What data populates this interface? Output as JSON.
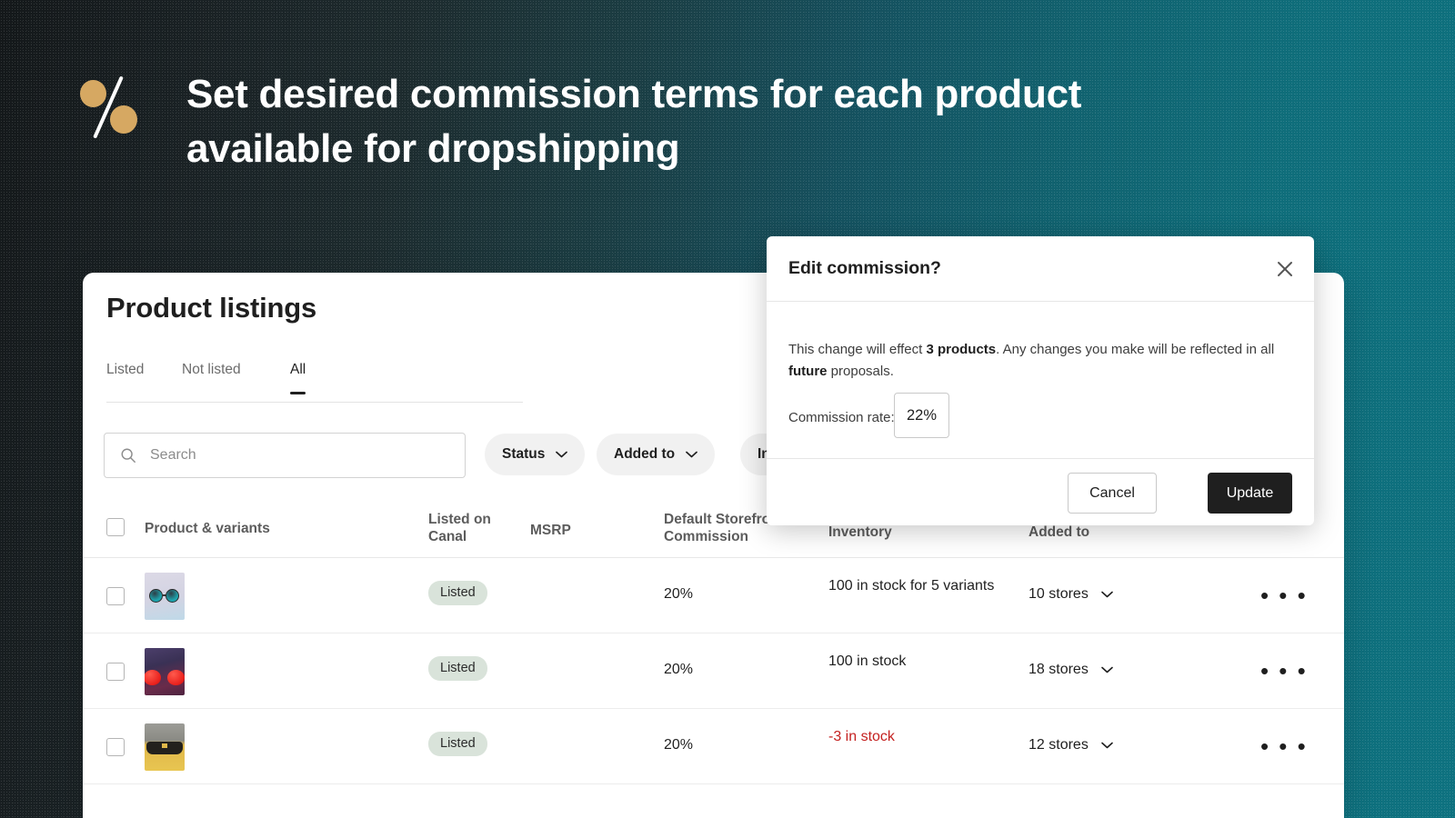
{
  "hero": {
    "title": "Set desired commission terms for each product available for dropshipping",
    "logo_icon": "percent-logo-icon",
    "accent_color": "#d6a862",
    "bg_from": "#14181a",
    "bg_to": "#0e7280"
  },
  "page": {
    "title": "Product listings"
  },
  "tabs": [
    {
      "label": "Listed",
      "active": false
    },
    {
      "label": "Not listed",
      "active": false
    },
    {
      "label": "All",
      "active": true
    }
  ],
  "search": {
    "placeholder": "Search",
    "value": "",
    "icon": "search-icon"
  },
  "filters": [
    {
      "label": "Status",
      "icon": "chevron-down-icon"
    },
    {
      "label": "Added to",
      "icon": "chevron-down-icon"
    },
    {
      "label": "In",
      "icon": "chevron-down-icon"
    }
  ],
  "table": {
    "headers": {
      "product": "Product & variants",
      "listed_on": "Listed on Canal",
      "msrp": "MSRP",
      "commission": "Default Storefront Commission",
      "inventory": "Inventory",
      "added_to": "Added to"
    },
    "rows": [
      {
        "thumb": "teal-round-sunglasses-thumbnail",
        "listed": "Listed",
        "msrp": "",
        "commission": "20%",
        "inventory": "100 in stock for 5 variants",
        "inventory_low": false,
        "added_to": "10 stores",
        "more": "• • •"
      },
      {
        "thumb": "red-lens-sunglasses-thumbnail",
        "listed": "Listed",
        "msrp": "",
        "commission": "20%",
        "inventory": "100 in stock",
        "inventory_low": false,
        "added_to": "18 stores",
        "more": "• • •"
      },
      {
        "thumb": "black-sunglasses-thumbnail",
        "listed": "Listed",
        "msrp": "",
        "commission": "20%",
        "inventory": "-3 in stock",
        "inventory_low": true,
        "added_to": "12 stores",
        "more": "• • •"
      }
    ],
    "badge_bg": "#d9e3da",
    "low_stock_color": "#c4201f"
  },
  "modal": {
    "title": "Edit commission?",
    "close_icon": "close-icon",
    "body_part_1": "This change will effect ",
    "body_bold_1": "3 products",
    "body_part_2": ".  Any changes you make will be reflected in all ",
    "body_bold_2": "future",
    "body_part_3": " proposals.",
    "rate_label": "Commission rate:",
    "rate_value": "22%",
    "cancel_label": "Cancel",
    "update_label": "Update",
    "update_bg": "#1f1f1f"
  }
}
